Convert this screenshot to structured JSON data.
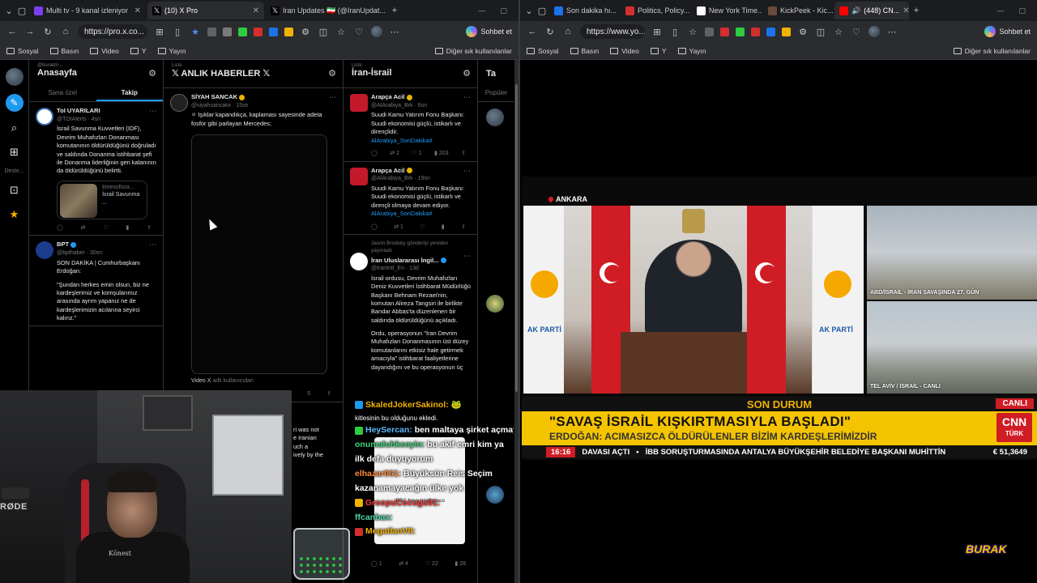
{
  "left_window": {
    "tabs": [
      {
        "label": "Multi tv - 9 kanal izleniyor",
        "color": "#7b3ff2"
      },
      {
        "label": "(10) X Pro",
        "color": "#ffffff"
      },
      {
        "label": "Iran Updates 🇮🇷 (@IranUpdat...",
        "color": "#ffffff"
      }
    ],
    "url": "https://pro.x.co...",
    "bookmarks": [
      "Sosyal",
      "Basın",
      "Video",
      "Y",
      "Yayın"
    ],
    "bookmarks_right": "Diğer sık kullanılanlar",
    "copilot_label": "Sohbet et"
  },
  "xpro": {
    "side_label": "Deste...",
    "col1": {
      "sub": "@buraktri...",
      "title": "Anasayfa",
      "tabs": [
        "Sana özel",
        "Takip"
      ],
      "tweets": [
        {
          "name": "ToI UYARILARI",
          "handle": "@TOIAlerts · 4sn",
          "text": "İsrail Savunma Kuvvetleri (IDF), Devrim Muhafızları Donanması komutanının öldürüldüğünü doğruladı ve saldında Donanma istihbarat şefi ile Donanma liderliğinin geri kalanının da öldürüldüğünü belirtti.",
          "card_site": "timesofisra...",
          "card_title": "İsrail Savunma ..."
        },
        {
          "name": "BPT",
          "handle": "@bpthaber · 30sn",
          "text": "SON DAKİKA | Cumhurbaşkanı Erdoğan:",
          "text2": "\"Şundan herkes emin olsun, biz ne kardeşlerimiz ve komşularımız arasında ayrım yapanız ne de kardeşlerimizin acılarına seyirci kalırız.\""
        }
      ]
    },
    "col2": {
      "sub": "Liste",
      "title": "𝕏 ANLIK HABERLER 𝕏",
      "tweet": {
        "name": "SİYAH SANCAK",
        "handle": "@siyahsancakx · 15sn",
        "text": "⚪ Işıklar kapandıkça, kaplaması sayesinde adeta fosfor gibi parlayan Mercedes;",
        "video_caption": "Video X",
        "video_caption_muted": "adlı kullanıcıdan",
        "count": "5"
      },
      "partial": [
        "ri was not",
        "e Iranian",
        "uch a",
        "ively by the"
      ]
    },
    "col3": {
      "sub": "Liste",
      "title": "İran-İsrail",
      "tweets": [
        {
          "name": "Arapça Acil",
          "handle": "@AlArabiya_Brk · 6sn",
          "text": "Suudi Kamu Yatırım Fonu Başkanı: Suudi ekonomisi güçlü, istikarlı ve dirençlidir.",
          "link": "AlArabiya_SonDakika#",
          "acts": [
            "",
            "2",
            "1",
            "203"
          ]
        },
        {
          "name": "Arapça Acil",
          "handle": "@AlArabiya_Brk · 19sn",
          "text": "Suudi Kamu Yatırım Fonu Başkanı: Suudi ekonomisi güçlü, istikarlı ve dirençli olmaya devam ediyor.",
          "link": "AlArabiya_SonDakika#",
          "acts": [
            "",
            "1",
            "",
            ""
          ]
        },
        {
          "retweet": "Jason Brodsky gönderiyi yeniden yayınladı",
          "name": "İran Uluslararası İngil...",
          "handle": "@IranIntl_En · 13d",
          "text": "İsrail ordusu, Devrim Muhafızları Deniz Kuvvetleri İstihbarat Müdürlüğü Başkanı Behnam Rezaei'nin, komutan Alireza Tangsiri ile birlikte Bandar Abbas'ta düzenlenen bir saldırıda öldürüldüğünü açıkladı.",
          "text2": "Ordu, operasyonun \"İran Devrim Muhafızları Donanmasının üst düzey komutanlarını etkisiz hale getirmek amacıyla\" istihbarat faaliyetlerine dayandığını ve bu operasyonun üç"
        }
      ],
      "bottom_acts": [
        "1",
        "4",
        "22",
        "28"
      ]
    },
    "col4": {
      "title": "Ta",
      "tab": "Popüler"
    }
  },
  "chat": [
    {
      "user": "SkaledJokerSakinol:",
      "msg": "🐸",
      "color": "#f2b200"
    },
    {
      "user": "",
      "msg": "kitlesinin bu olduğunu ekledi.",
      "color": "#ffffff"
    },
    {
      "user": "HeySercan:",
      "msg": "ben maltaya şirket açmaya gidiyorum",
      "color": "#5cb8ff"
    },
    {
      "user": "onumaluhkseyin:",
      "msg": "bu akif emri kim ya ilk defa duyuyorum",
      "color": "#3fd27a"
    },
    {
      "user": "elhazar061:",
      "msg": "Büyüksün Reis Seçim kazanamayacağın ülke yok",
      "color": "#ff8a3d"
    },
    {
      "user": "GroopuCocugu01:",
      "msg": "",
      "color": "#ff3b3b"
    },
    {
      "user": "ffcanbax:",
      "msg": "",
      "color": "#4fd1a5"
    },
    {
      "user": "MegatlanVII:",
      "msg": "",
      "color": "#f2b200"
    }
  ],
  "popup_text": "IRGC Navy Intelligence",
  "webcam": {
    "mic_label": "RØDE",
    "shirt_logo": "Kōnest"
  },
  "right_window": {
    "tabs": [
      {
        "label": "Son dakika hı...",
        "color": "#1a73e8"
      },
      {
        "label": "Politics, Policy...",
        "color": "#d32f2f"
      },
      {
        "label": "New York Time...",
        "color": "#ffffff"
      },
      {
        "label": "KickPeek - Kic...",
        "color": "#333333"
      },
      {
        "label": "(448) CN...",
        "color": "#ff0000"
      }
    ],
    "url": "https://www.yo...",
    "bookmarks": [
      "Sosyal",
      "Basın",
      "Video",
      "Y",
      "Yayın"
    ],
    "bookmarks_right": "Diğer sık kullanılanlar",
    "copilot_label": "Sohbet et"
  },
  "broadcast": {
    "location": "ANKARA",
    "side1_label": "ABD/İSRAİL - İRAN SAVAŞINDA 27. GÜN",
    "side2_label": "TEL AVİV / İSRAİL - CANLI",
    "son_durum": "SON DURUM",
    "canli": "CANLI",
    "headline": "\"SAVAŞ İSRAİL KIŞKIRTMASIYLA BAŞLADI\"",
    "subheadline": "ERDOĞAN: ACIMASIZCA ÖLDÜRÜLENLER BİZİM KARDEŞLERİMİZDİR",
    "network": "CNN",
    "network_sub": "TÜRK",
    "time": "16:16",
    "ticker_a": "DAVASI AÇTI",
    "ticker_b": "İBB SORUŞTURMASINDA ANTALYA BÜYÜKŞEHİR BELEDİYE BAŞKANI MUHİTTİN",
    "currency": "€ 51,3649",
    "podium_left": "AK PARTİ",
    "podium_right": "AK PARTİ"
  },
  "streamer_logo": "BURAK"
}
